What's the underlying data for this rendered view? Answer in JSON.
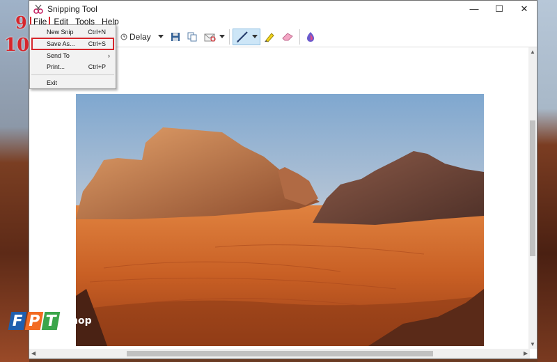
{
  "window": {
    "title": "Snipping Tool",
    "controls": {
      "minimize": "—",
      "maximize": "☐",
      "close": "✕"
    }
  },
  "annotations": {
    "step9": "9",
    "step10": "10"
  },
  "menubar": {
    "items": [
      "File",
      "Edit",
      "Tools",
      "Help"
    ]
  },
  "toolbar": {
    "delay_label": "Delay"
  },
  "file_menu": {
    "items": [
      {
        "label": "New Snip",
        "shortcut": "Ctrl+N"
      },
      {
        "label": "Save As...",
        "shortcut": "Ctrl+S"
      },
      {
        "label": "Send To",
        "shortcut": ""
      },
      {
        "label": "Print...",
        "shortcut": "Ctrl+P"
      },
      {
        "label": "Exit",
        "shortcut": ""
      }
    ],
    "submenu_arrow": "›"
  },
  "watermark": {
    "letters": [
      "F",
      "P",
      "T"
    ],
    "shop": "Shop"
  },
  "colors": {
    "accent_red": "#d6262c",
    "fpt_blue": "#1f5fae",
    "fpt_orange": "#f26b22",
    "fpt_green": "#3aa54a"
  }
}
